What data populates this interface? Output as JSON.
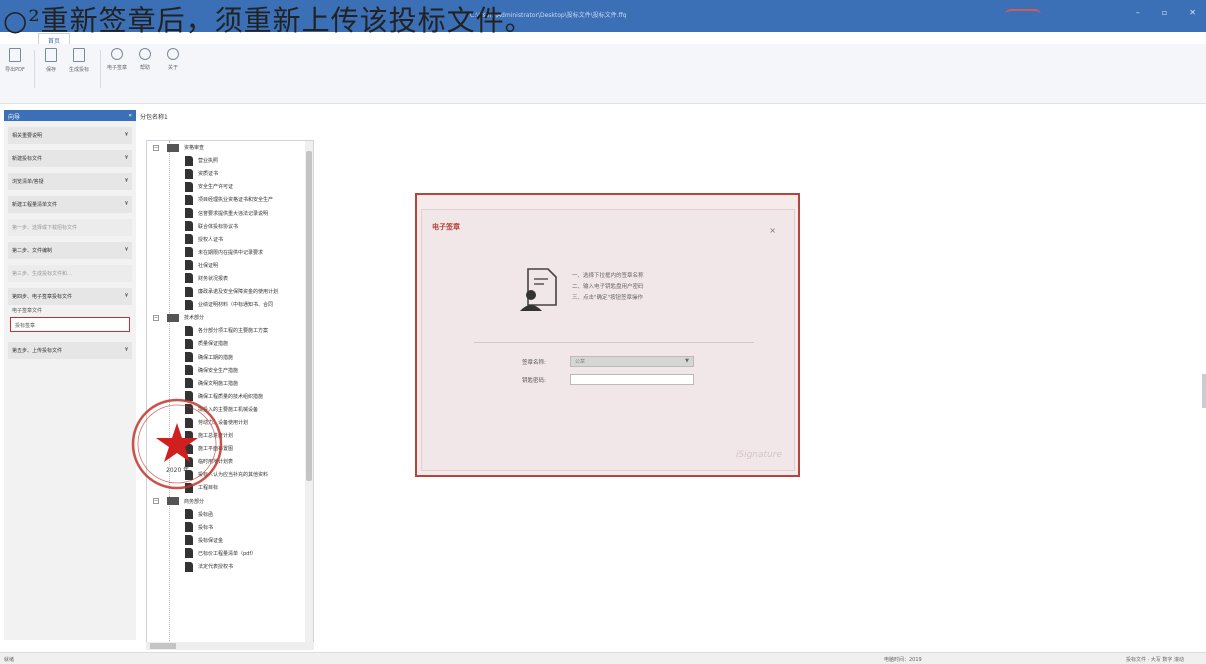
{
  "overlay_caption": "○²重新签章后，须重新上传该投标文件。",
  "window": {
    "title_path": "C:\\Users\\Administrator\\Desktop\\投标文件\\投标文件.ffq",
    "minimize": "–",
    "maximize": "▫",
    "close": "✕"
  },
  "menu_tabs": [
    "文件",
    "首页"
  ],
  "ribbon": {
    "groups": [
      [
        "导出PDF"
      ],
      [
        "保存",
        "生成投标"
      ],
      [
        "电子签章",
        "帮助",
        "关于"
      ]
    ]
  },
  "nav": {
    "title": "向导",
    "collapse": "«",
    "items": [
      {
        "label": "相关重要说明",
        "arrow": "¥"
      },
      {
        "label": "新建投标文件",
        "arrow": "¥"
      },
      {
        "label": "浏览清单/答疑",
        "arrow": "¥"
      },
      {
        "label": "新建工程量清单文件",
        "arrow": "¥"
      },
      {
        "label": "第一步、选择或下载招标文件",
        "arrow": ""
      },
      {
        "label": "第二步、文件编制",
        "arrow": "¥"
      },
      {
        "label": "第三步、生成投标文件和…",
        "arrow": ""
      },
      {
        "label": "第四步、电子签章投标文件",
        "arrow": "¥"
      }
    ],
    "subitems": [
      "电子签章文件",
      "投标签章"
    ],
    "last_item": {
      "label": "第五步、上传投标文件",
      "arrow": "¥"
    }
  },
  "tree": {
    "title": "分包名称1",
    "nodes": [
      {
        "kind": "folder",
        "label": "资格审查"
      },
      {
        "kind": "file",
        "label": "营业执照"
      },
      {
        "kind": "file",
        "label": "资质证书"
      },
      {
        "kind": "file",
        "label": "安全生产许可证"
      },
      {
        "kind": "file",
        "label": "项目经理执业资格证书和安全生产"
      },
      {
        "kind": "file",
        "label": "信誉要求提供重大违法记录说明"
      },
      {
        "kind": "file",
        "label": "联合体投标协议书"
      },
      {
        "kind": "file",
        "label": "授权人证书"
      },
      {
        "kind": "file",
        "label": "未在期限内在提供中记录要求"
      },
      {
        "kind": "file",
        "label": "社保证明"
      },
      {
        "kind": "file",
        "label": "财务状况报表"
      },
      {
        "kind": "file",
        "label": "廉政承诺及安全保障资金的使用计划"
      },
      {
        "kind": "file",
        "label": "业绩证明材料（中标通知书、合同"
      },
      {
        "kind": "folder",
        "label": "技术部分"
      },
      {
        "kind": "file",
        "label": "各分部分项工程的主要施工方案"
      },
      {
        "kind": "file",
        "label": "质量保证措施"
      },
      {
        "kind": "file",
        "label": "确保工期的措施"
      },
      {
        "kind": "file",
        "label": "确保安全生产措施"
      },
      {
        "kind": "file",
        "label": "确保文明施工措施"
      },
      {
        "kind": "file",
        "label": "确保工程质量的技术组织措施"
      },
      {
        "kind": "file",
        "label": "拟投入的主要施工机械设备"
      },
      {
        "kind": "file",
        "label": "劳动力、设备使用计划"
      },
      {
        "kind": "file",
        "label": "施工总进度计划"
      },
      {
        "kind": "file",
        "label": "施工平面布置图"
      },
      {
        "kind": "file",
        "label": "临时用地计划表"
      },
      {
        "kind": "file",
        "label": "投标人认为应当补充的其他资料"
      },
      {
        "kind": "file",
        "label": "工程目标"
      },
      {
        "kind": "folder",
        "label": "商务部分"
      },
      {
        "kind": "file",
        "label": "投标函"
      },
      {
        "kind": "file",
        "label": "投标书"
      },
      {
        "kind": "file",
        "label": "投标保证金"
      },
      {
        "kind": "file",
        "label": "已标价工程量清单（pdf）"
      },
      {
        "kind": "file",
        "label": "法定代表授权书"
      }
    ]
  },
  "seal_caption": "2020 年",
  "dialog": {
    "title": "电子签章",
    "close": "×",
    "steps": [
      "一、选择下拉框内的签章名称",
      "二、输入电子钥匙盘用户密码",
      "三、点击\"确定\"按钮签章操作"
    ],
    "seal_label": "签章名称:",
    "seal_value": "公章",
    "password_label": "钥匙密码:",
    "password_value": "",
    "watermark": "iSignature",
    "colors": {
      "border": "#b5443c",
      "background": "#f2e7e8"
    }
  },
  "statusbar": {
    "left": "就绪",
    "middle": "电脑时间：2019",
    "right": "投标文件 · 大写 数字 滚动"
  }
}
